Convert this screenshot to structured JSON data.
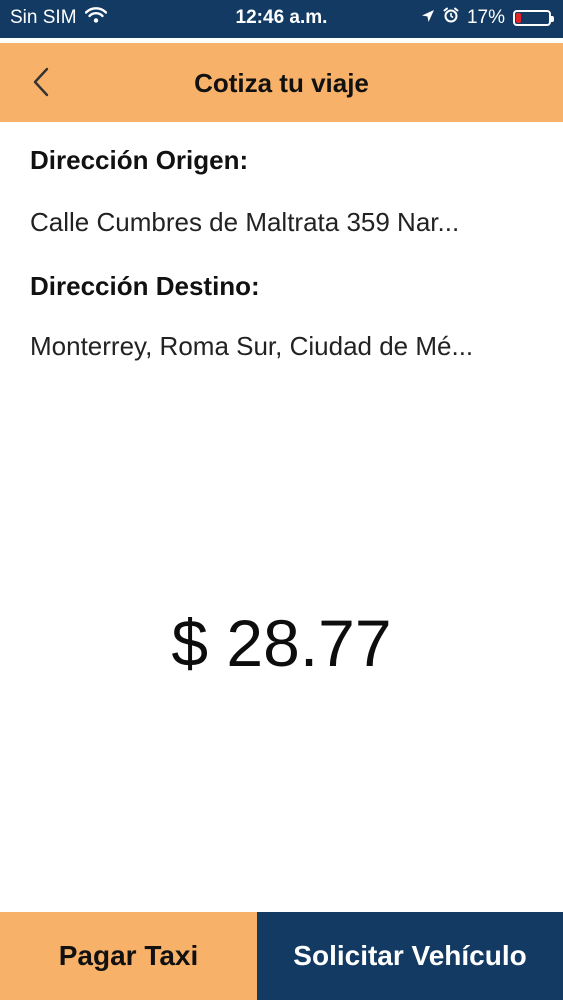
{
  "status_bar": {
    "carrier": "Sin SIM",
    "time": "12:46 a.m.",
    "battery_percent": "17%",
    "battery_level": 0.17,
    "background_color": "#123a63"
  },
  "nav": {
    "title": "Cotiza tu viaje",
    "background_color": "#f8b168"
  },
  "trip": {
    "origin_label": "Dirección Origen:",
    "origin_value": "Calle Cumbres de Maltrata 359 Nar...",
    "destination_label": "Dirección Destino:",
    "destination_value": "Monterrey, Roma Sur, Ciudad de Mé..."
  },
  "quote": {
    "price": "$ 28.77"
  },
  "footer": {
    "pay_label": "Pagar Taxi",
    "request_label": "Solicitar Vehículo",
    "pay_color": "#f8b168",
    "request_color": "#123a63"
  },
  "icons": [
    "wifi-icon",
    "location-arrow-icon",
    "alarm-icon",
    "battery-icon",
    "back-chevron-icon"
  ]
}
